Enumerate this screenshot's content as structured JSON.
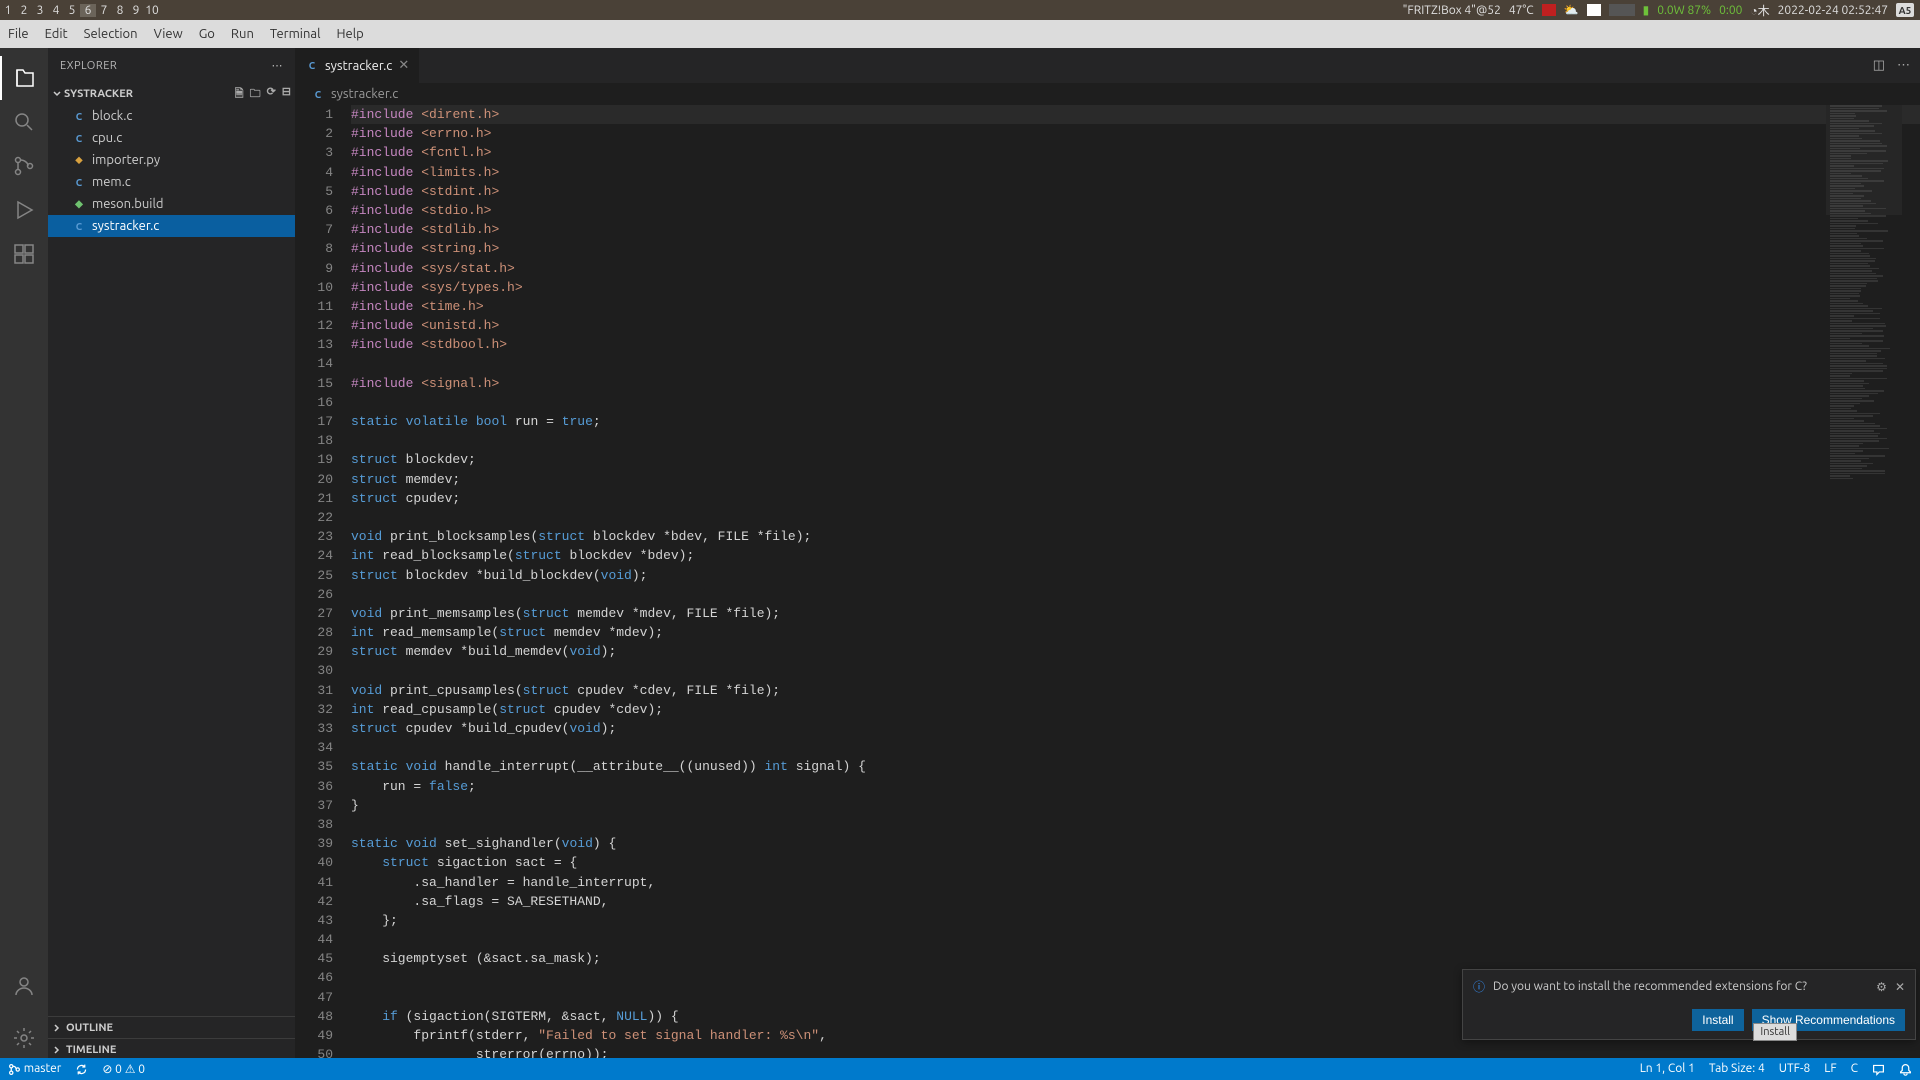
{
  "system": {
    "workspaces": [
      "1",
      "2",
      "3",
      "4",
      "5",
      "6",
      "7",
      "8",
      "9",
      "10"
    ],
    "active_workspace": 5,
    "wifi": "\"FRITZ!Box 4\"@52",
    "temp": "47°C",
    "power": "0.0W 87%",
    "time_remaining": "0:00",
    "datetime": "2022-02-24 02:52:47",
    "ime": "A5",
    "clock_icon": "◔木"
  },
  "menu": [
    "File",
    "Edit",
    "Selection",
    "View",
    "Go",
    "Run",
    "Terminal",
    "Help"
  ],
  "sidebar": {
    "title": "EXPLORER",
    "project": "SYSTRACKER",
    "files": [
      {
        "icon": "C",
        "cls": "c-icon",
        "name": "block.c"
      },
      {
        "icon": "C",
        "cls": "c-icon",
        "name": "cpu.c"
      },
      {
        "icon": "⬥",
        "cls": "py-icon",
        "name": "importer.py"
      },
      {
        "icon": "C",
        "cls": "c-icon",
        "name": "mem.c"
      },
      {
        "icon": "◆",
        "cls": "meson-icon",
        "name": "meson.build"
      },
      {
        "icon": "C",
        "cls": "c-icon",
        "name": "systracker.c",
        "selected": true
      }
    ],
    "outline": "OUTLINE",
    "timeline": "TIMELINE"
  },
  "tab": {
    "filename": "systracker.c",
    "breadcrumb": "systracker.c"
  },
  "code": [
    [
      [
        "macro",
        "#include"
      ],
      [
        "plain",
        " "
      ],
      [
        "string",
        "<dirent.h>"
      ]
    ],
    [
      [
        "macro",
        "#include"
      ],
      [
        "plain",
        " "
      ],
      [
        "string",
        "<errno.h>"
      ]
    ],
    [
      [
        "macro",
        "#include"
      ],
      [
        "plain",
        " "
      ],
      [
        "string",
        "<fcntl.h>"
      ]
    ],
    [
      [
        "macro",
        "#include"
      ],
      [
        "plain",
        " "
      ],
      [
        "string",
        "<limits.h>"
      ]
    ],
    [
      [
        "macro",
        "#include"
      ],
      [
        "plain",
        " "
      ],
      [
        "string",
        "<stdint.h>"
      ]
    ],
    [
      [
        "macro",
        "#include"
      ],
      [
        "plain",
        " "
      ],
      [
        "string",
        "<stdio.h>"
      ]
    ],
    [
      [
        "macro",
        "#include"
      ],
      [
        "plain",
        " "
      ],
      [
        "string",
        "<stdlib.h>"
      ]
    ],
    [
      [
        "macro",
        "#include"
      ],
      [
        "plain",
        " "
      ],
      [
        "string",
        "<string.h>"
      ]
    ],
    [
      [
        "macro",
        "#include"
      ],
      [
        "plain",
        " "
      ],
      [
        "string",
        "<sys/stat.h>"
      ]
    ],
    [
      [
        "macro",
        "#include"
      ],
      [
        "plain",
        " "
      ],
      [
        "string",
        "<sys/types.h>"
      ]
    ],
    [
      [
        "macro",
        "#include"
      ],
      [
        "plain",
        " "
      ],
      [
        "string",
        "<time.h>"
      ]
    ],
    [
      [
        "macro",
        "#include"
      ],
      [
        "plain",
        " "
      ],
      [
        "string",
        "<unistd.h>"
      ]
    ],
    [
      [
        "macro",
        "#include"
      ],
      [
        "plain",
        " "
      ],
      [
        "string",
        "<stdbool.h>"
      ]
    ],
    [],
    [
      [
        "macro",
        "#include"
      ],
      [
        "plain",
        " "
      ],
      [
        "string",
        "<signal.h>"
      ]
    ],
    [],
    [
      [
        "keyword",
        "static"
      ],
      [
        "plain",
        " "
      ],
      [
        "keyword",
        "volatile"
      ],
      [
        "plain",
        " "
      ],
      [
        "type",
        "bool"
      ],
      [
        "plain",
        " run = "
      ],
      [
        "const",
        "true"
      ],
      [
        "plain",
        ";"
      ]
    ],
    [],
    [
      [
        "keyword",
        "struct"
      ],
      [
        "plain",
        " blockdev;"
      ]
    ],
    [
      [
        "keyword",
        "struct"
      ],
      [
        "plain",
        " memdev;"
      ]
    ],
    [
      [
        "keyword",
        "struct"
      ],
      [
        "plain",
        " cpudev;"
      ]
    ],
    [],
    [
      [
        "type",
        "void"
      ],
      [
        "plain",
        " print_blocksamples("
      ],
      [
        "keyword",
        "struct"
      ],
      [
        "plain",
        " blockdev *bdev, FILE *file);"
      ]
    ],
    [
      [
        "type",
        "int"
      ],
      [
        "plain",
        " read_blocksample("
      ],
      [
        "keyword",
        "struct"
      ],
      [
        "plain",
        " blockdev *bdev);"
      ]
    ],
    [
      [
        "keyword",
        "struct"
      ],
      [
        "plain",
        " blockdev *build_blockdev("
      ],
      [
        "type",
        "void"
      ],
      [
        "plain",
        ");"
      ]
    ],
    [],
    [
      [
        "type",
        "void"
      ],
      [
        "plain",
        " print_memsamples("
      ],
      [
        "keyword",
        "struct"
      ],
      [
        "plain",
        " memdev *mdev, FILE *file);"
      ]
    ],
    [
      [
        "type",
        "int"
      ],
      [
        "plain",
        " read_memsample("
      ],
      [
        "keyword",
        "struct"
      ],
      [
        "plain",
        " memdev *mdev);"
      ]
    ],
    [
      [
        "keyword",
        "struct"
      ],
      [
        "plain",
        " memdev *build_memdev("
      ],
      [
        "type",
        "void"
      ],
      [
        "plain",
        ");"
      ]
    ],
    [],
    [
      [
        "type",
        "void"
      ],
      [
        "plain",
        " print_cpusamples("
      ],
      [
        "keyword",
        "struct"
      ],
      [
        "plain",
        " cpudev *cdev, FILE *file);"
      ]
    ],
    [
      [
        "type",
        "int"
      ],
      [
        "plain",
        " read_cpusample("
      ],
      [
        "keyword",
        "struct"
      ],
      [
        "plain",
        " cpudev *cdev);"
      ]
    ],
    [
      [
        "keyword",
        "struct"
      ],
      [
        "plain",
        " cpudev *build_cpudev("
      ],
      [
        "type",
        "void"
      ],
      [
        "plain",
        ");"
      ]
    ],
    [],
    [
      [
        "keyword",
        "static"
      ],
      [
        "plain",
        " "
      ],
      [
        "type",
        "void"
      ],
      [
        "plain",
        " handle_interrupt(__attribute__((unused)) "
      ],
      [
        "type",
        "int"
      ],
      [
        "plain",
        " signal) {"
      ]
    ],
    [
      [
        "plain",
        "    run = "
      ],
      [
        "const",
        "false"
      ],
      [
        "plain",
        ";"
      ]
    ],
    [
      [
        "plain",
        "}"
      ]
    ],
    [],
    [
      [
        "keyword",
        "static"
      ],
      [
        "plain",
        " "
      ],
      [
        "type",
        "void"
      ],
      [
        "plain",
        " set_sighandler("
      ],
      [
        "type",
        "void"
      ],
      [
        "plain",
        ") {"
      ]
    ],
    [
      [
        "plain",
        "    "
      ],
      [
        "keyword",
        "struct"
      ],
      [
        "plain",
        " sigaction sact = {"
      ]
    ],
    [
      [
        "plain",
        "        .sa_handler = handle_interrupt,"
      ]
    ],
    [
      [
        "plain",
        "        .sa_flags = SA_RESETHAND,"
      ]
    ],
    [
      [
        "plain",
        "    };"
      ]
    ],
    [],
    [
      [
        "plain",
        "    sigemptyset (&sact.sa_mask);"
      ]
    ],
    [],
    [],
    [
      [
        "plain",
        "    "
      ],
      [
        "keyword",
        "if"
      ],
      [
        "plain",
        " (sigaction(SIGTERM, &sact, "
      ],
      [
        "null",
        "NULL"
      ],
      [
        "plain",
        ")) {"
      ]
    ],
    [
      [
        "plain",
        "        fprintf(stderr, "
      ],
      [
        "string",
        "\"Failed to set signal handler: %s\\n\""
      ],
      [
        "plain",
        ","
      ]
    ],
    [
      [
        "plain",
        "                strerror(errno));"
      ]
    ]
  ],
  "notification": {
    "text": "Do you want to install the recommended extensions for C?",
    "install": "Install",
    "show": "Show Recommendations",
    "tooltip": "Install"
  },
  "status": {
    "branch": "master",
    "errors": "0",
    "warnings": "0",
    "lncol": "Ln 1, Col 1",
    "tabsize": "Tab Size: 4",
    "encoding": "UTF-8",
    "eol": "LF",
    "lang": "C"
  }
}
